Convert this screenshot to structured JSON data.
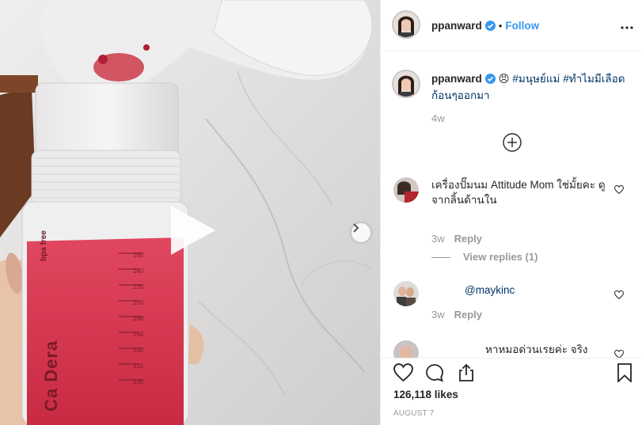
{
  "post": {
    "author": "ppanward",
    "follow_label": "Follow",
    "separator": "•",
    "verified_icon": "verified-badge-icon",
    "caption_emoji": "😠",
    "caption_hashtag1": "#มนุษย์แม่",
    "caption_hashtag2": "#ทำไมมีเลือดก้อนๆออกมา",
    "caption_time": "4w",
    "likes": "126,118 likes",
    "date": "AUGUST 7"
  },
  "media": {
    "bottle_brand": "Ca Dera",
    "bottle_label": "bpa free",
    "bottle_marks": [
      "260",
      "240",
      "220",
      "200",
      "180",
      "160",
      "140",
      "120",
      "100"
    ]
  },
  "comments": [
    {
      "text": "เครื่องปั๊มนม Attitude Mom ใช่มั้ยคะ ดูจากลิ้นด้านใน",
      "time": "3w",
      "reply_label": "Reply",
      "view_replies": "View replies (1)"
    },
    {
      "text": "@maykinc",
      "time": "3w",
      "reply_label": "Reply"
    },
    {
      "text": "หาหมอด่วนเรยค่ะ จริง"
    }
  ],
  "colors": {
    "link": "#3897f0",
    "hashtag": "#003569",
    "muted": "#999999",
    "text": "#262626",
    "milk": "#d9354f"
  }
}
